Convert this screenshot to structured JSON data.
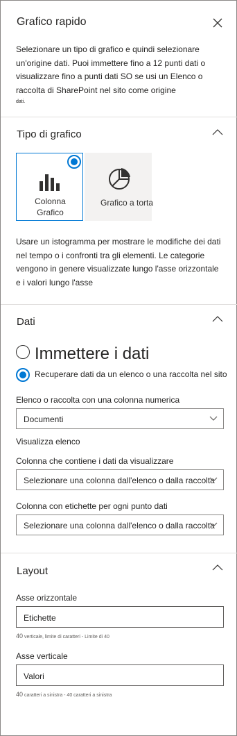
{
  "header": {
    "title": "Grafico rapido",
    "intro": "Selezionare un tipo di grafico e quindi selezionare un'origine dati. Puoi immettere fino a 12 punti dati o visualizzare fino a punti dati SO se usi un Elenco o raccolta di SharePoint nel sito come origine",
    "intro_small": "dati."
  },
  "chart_type": {
    "section_title": "Tipo di grafico",
    "options": [
      {
        "label_line1": "Colonna",
        "label_line2": "Grafico",
        "icon": "bar-chart-icon",
        "selected": true
      },
      {
        "label": "Grafico a torta",
        "icon": "pie-chart-icon",
        "selected": false
      }
    ],
    "description": "Usare un istogramma per mostrare le modifiche dei dati nel tempo o i confronti tra gli elementi. Le categorie vengono in genere visualizzate lungo l'asse orizzontale e i valori lungo l'asse"
  },
  "data_section": {
    "section_title": "Dati",
    "radio_enter": "Immettere i dati",
    "radio_retrieve": "Recuperare dati da un elenco o una raccolta nel sito",
    "list_label": "Elenco o raccolta con una colonna numerica",
    "list_value": "Documenti",
    "view_list": "Visualizza elenco",
    "column_values_label": "Colonna che contiene i dati da visualizzare",
    "column_values_placeholder": "Selezionare una colonna dall'elenco o dalla raccolta",
    "column_labels_label": "Colonna con etichette per ogni punto dati",
    "column_labels_placeholder": "Selezionare una colonna dall'elenco o dalla raccolta"
  },
  "layout_section": {
    "section_title": "Layout",
    "x_axis_label": "Asse orizzontale",
    "x_axis_value": "Etichette",
    "x_hint_num": "40",
    "x_hint_text": "verticale, limite di caratteri - Limite di 40",
    "y_axis_label": "Asse verticale",
    "y_axis_value": "Valori",
    "y_hint_num": "40",
    "y_hint_text": "caratteri a sinistra - 40 caratteri a sinistra"
  },
  "colors": {
    "accent": "#0078d4",
    "text": "#252423",
    "divider": "#e1dfdd"
  }
}
